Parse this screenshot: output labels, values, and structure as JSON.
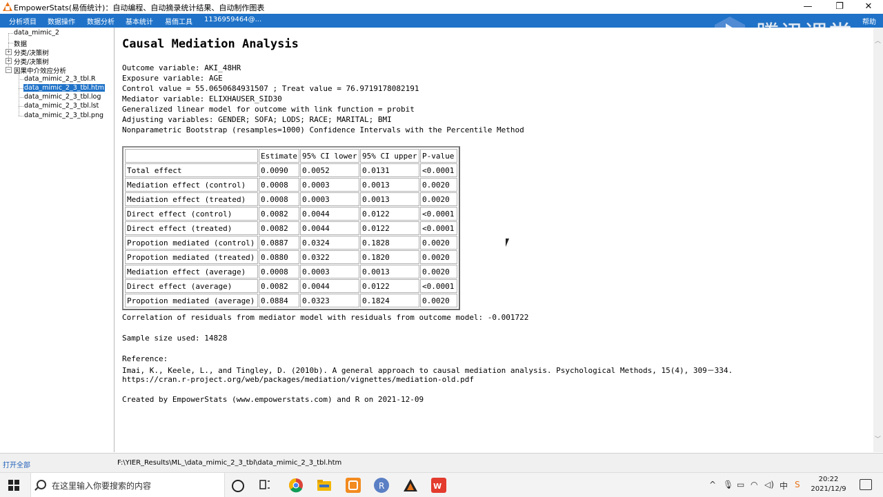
{
  "window": {
    "title": "EmpowerStats(易侕统计)：自动编程、自动摘录统计结果、自动制作图表",
    "minimize_glyph": "—",
    "restore_glyph": "❐",
    "close_glyph": "✕"
  },
  "menu": {
    "items": [
      "分析项目",
      "数据操作",
      "数据分析",
      "基本统计",
      "易侕工具",
      "1136959464@..."
    ],
    "help": "帮助"
  },
  "watermark": {
    "text": "腾讯课堂"
  },
  "tree": {
    "root": "data_mimic_2",
    "data": "数据",
    "groups": [
      "分类/决策树",
      "分类/决策树",
      "因果中介效应分析"
    ],
    "files": [
      "data_mimic_2_3_tbl.R",
      "data_mimic_2_3_tbl.htm",
      "data_mimic_2_3_tbl.log",
      "data_mimic_2_3_tbl.lst",
      "data_mimic_2_3_tbl.png"
    ],
    "selected_file": "data_mimic_2_3_tbl.htm"
  },
  "report": {
    "heading": "Causal Mediation Analysis",
    "info": [
      "Outcome variable: AKI_48HR",
      "Exposure variable: AGE",
      "Control value = 55.0650684931507 ; Treat value = 76.9719178082191",
      "Mediator variable: ELIXHAUSER_SID30",
      "Generalized linear model for outcome with link function = probit",
      "Adjusting variables: GENDER; SOFA; LODS; RACE; MARITAL; BMI",
      "Nonparametric Bootstrap (resamples=1000) Confidence Intervals with the Percentile Method"
    ],
    "table": {
      "headers": [
        "",
        "Estimate",
        "95% CI lower",
        "95% CI upper",
        "P-value"
      ],
      "rows": [
        [
          "Total effect",
          "0.0090",
          "0.0052",
          "0.0131",
          "<0.0001"
        ],
        [
          "Mediation effect (control)",
          "0.0008",
          "0.0003",
          "0.0013",
          "0.0020"
        ],
        [
          "Mediation effect (treated)",
          "0.0008",
          "0.0003",
          "0.0013",
          "0.0020"
        ],
        [
          "Direct effect (control)",
          "0.0082",
          "0.0044",
          "0.0122",
          "<0.0001"
        ],
        [
          "Direct effect (treated)",
          "0.0082",
          "0.0044",
          "0.0122",
          "<0.0001"
        ],
        [
          "Propotion mediated (control)",
          "0.0887",
          "0.0324",
          "0.1828",
          "0.0020"
        ],
        [
          "Propotion mediated (treated)",
          "0.0880",
          "0.0322",
          "0.1820",
          "0.0020"
        ],
        [
          "Mediation effect (average)",
          "0.0008",
          "0.0003",
          "0.0013",
          "0.0020"
        ],
        [
          "Direct effect (average)",
          "0.0082",
          "0.0044",
          "0.0122",
          "<0.0001"
        ],
        [
          "Propotion mediated (average)",
          "0.0884",
          "0.0323",
          "0.1824",
          "0.0020"
        ]
      ]
    },
    "correlation": "Correlation of residuals from mediator model with residuals from outcome model: -0.001722",
    "sample_size": "Sample size used: 14828",
    "reference_label": "Reference:",
    "reference_text": "Imai, K., Keele, L., and Tingley, D. (2010b). A general approach to causal mediation analysis. Psychological Methods, 15(4), 309－334.",
    "reference_url": "https://cran.r-project.org/web/packages/mediation/vignettes/mediation-old.pdf",
    "created_by": "Created by EmpowerStats (www.empowerstats.com) and R on 2021-12-09"
  },
  "statusbar": {
    "open_all": "打开全部",
    "path": "F:\\YIER_Results\\ML_\\data_mimic_2_3_tbl\\data_mimic_2_3_tbl.htm"
  },
  "taskbar": {
    "search_placeholder": "在这里输入你要搜索的内容",
    "clock_time": "20:22",
    "clock_date": "2021/12/9",
    "ime_label": "中",
    "icons": [
      "cortana-icon",
      "task-view-icon",
      "chrome-icon",
      "file-explorer-icon",
      "sticky-app-icon",
      "r-icon",
      "empowerstats-icon",
      "wps-icon"
    ],
    "colors": {
      "menubar": "#1f72c8",
      "chrome": "#db4437",
      "explorer": "#f2b705",
      "r": "#5a7fc4",
      "wps": "#e33b2e",
      "app_orange": "#e8741a"
    }
  }
}
